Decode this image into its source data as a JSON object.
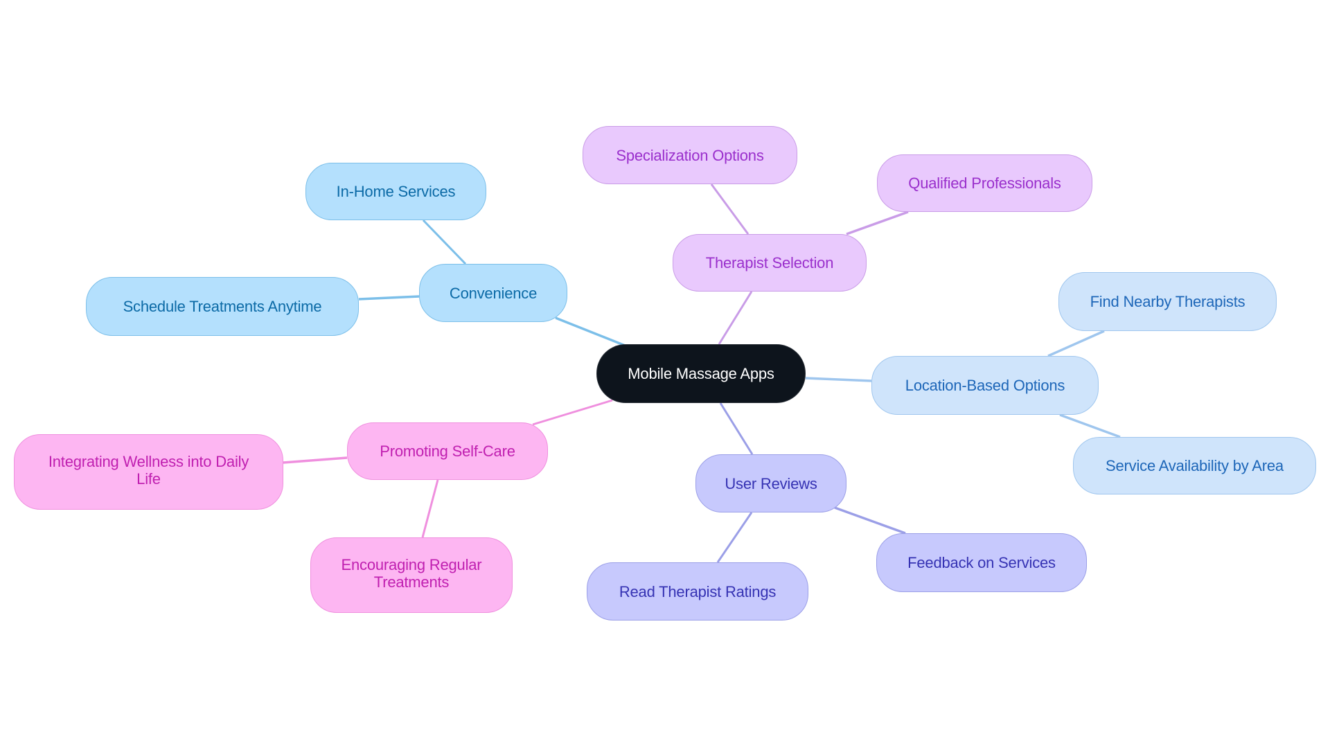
{
  "diagram": {
    "type": "mind-map",
    "root": {
      "id": "root",
      "label": "Mobile Massage Apps"
    },
    "colors": {
      "root": "#0d141c",
      "convenience": "#b4e0fd",
      "therapist_selection": "#e9c9fd",
      "location_based": "#cfe4fb",
      "user_reviews": "#c7c9fd",
      "self_care": "#fdb6f2"
    },
    "branches": [
      {
        "id": "convenience",
        "label": "Convenience",
        "children": [
          {
            "id": "in-home",
            "label": "In-Home Services"
          },
          {
            "id": "schedule",
            "label": "Schedule Treatments Anytime"
          }
        ]
      },
      {
        "id": "therapist-selection",
        "label": "Therapist Selection",
        "children": [
          {
            "id": "specialization",
            "label": "Specialization Options"
          },
          {
            "id": "qualified",
            "label": "Qualified Professionals"
          }
        ]
      },
      {
        "id": "location-based",
        "label": "Location-Based Options",
        "children": [
          {
            "id": "find-nearby",
            "label": "Find Nearby Therapists"
          },
          {
            "id": "availability",
            "label": "Service Availability by Area"
          }
        ]
      },
      {
        "id": "user-reviews",
        "label": "User Reviews",
        "children": [
          {
            "id": "feedback",
            "label": "Feedback on Services"
          },
          {
            "id": "ratings",
            "label": "Read Therapist Ratings"
          }
        ]
      },
      {
        "id": "self-care",
        "label": "Promoting Self-Care",
        "children": [
          {
            "id": "wellness",
            "label": "Integrating Wellness into Daily Life"
          },
          {
            "id": "regular",
            "label": "Encouraging Regular Treatments"
          }
        ]
      }
    ]
  }
}
